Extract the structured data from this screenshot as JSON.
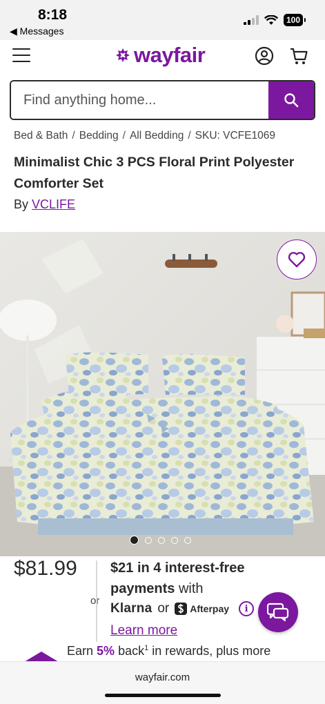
{
  "status_bar": {
    "time": "8:18",
    "back_label": "◀ Messages",
    "battery": "100"
  },
  "header": {
    "logo_text": "wayfair",
    "brand_color": "#7b189f"
  },
  "search": {
    "placeholder": "Find anything home..."
  },
  "breadcrumb": {
    "items": [
      "Bed & Bath",
      "Bedding",
      "All Bedding",
      "SKU: VCFE1069"
    ],
    "separator": "/"
  },
  "product": {
    "title": "Minimalist Chic 3 PCS Floral Print Polyester Comforter Set",
    "by_label": "By",
    "brand": "VCLIFE",
    "image_dots": 5,
    "active_dot": 1
  },
  "pricing": {
    "price": "$81.99",
    "or_label": "or",
    "installment_amount": "$21",
    "installment_text_bold": "in 4 interest-free",
    "installment_text_bold2": "payments",
    "installment_text_tail": "with",
    "klarna": "Klarna",
    "or_inline": "or",
    "afterpay": "Afterpay",
    "info_glyph": "i",
    "learn_more": "Learn more"
  },
  "rewards": {
    "prefix": "Earn",
    "percent": "5%",
    "text": "back",
    "superscript": "1",
    "suffix": "in rewards, plus more"
  },
  "url_bar": {
    "url": "wayfair.com"
  },
  "icons": {
    "menu": "hamburger-icon",
    "account": "account-icon",
    "cart": "cart-icon",
    "search": "search-icon",
    "favorite": "heart-icon",
    "chat": "chat-icon",
    "info": "info-icon"
  }
}
